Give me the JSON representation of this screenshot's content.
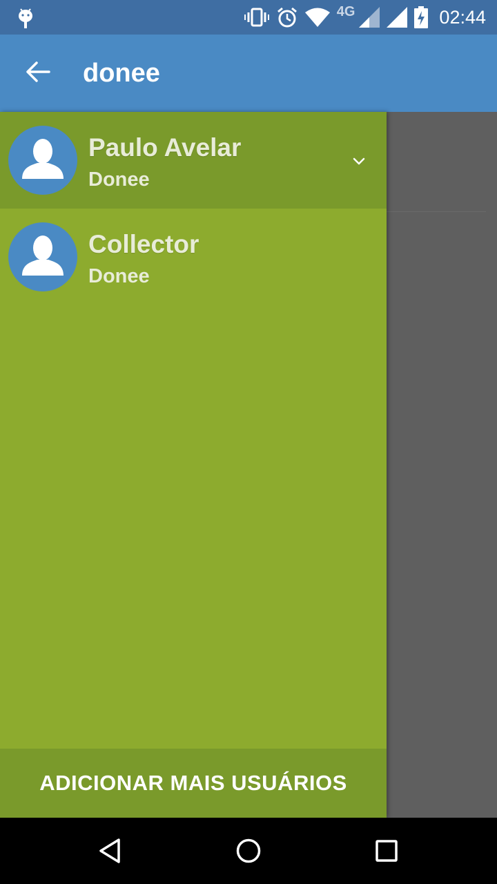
{
  "status_bar": {
    "network_label": "4G",
    "time": "02:44",
    "icons": [
      "android-debug-icon",
      "vibrate-icon",
      "alarm-icon",
      "wifi-icon",
      "signal-icon",
      "signal-icon",
      "battery-charging-icon"
    ]
  },
  "app_bar": {
    "back_icon": "arrow-back-icon",
    "title": "donee"
  },
  "drawer": {
    "accounts": [
      {
        "name": "Paulo Avelar",
        "role": "Donee",
        "active": true
      },
      {
        "name": "Collector",
        "role": "Donee",
        "active": false
      }
    ],
    "footer_label": "ADICIONAR MAIS USUÁRIOS"
  },
  "navigation": [
    "nav-back-icon",
    "nav-home-icon",
    "nav-recents-icon"
  ],
  "colors": {
    "status_bar": "#3f6ea3",
    "app_bar": "#4a8ac4",
    "drawer": "#8dab2e",
    "drawer_active": "#7a9a2b",
    "avatar": "#4a8ac4",
    "scrim": "#5f5f5f"
  }
}
